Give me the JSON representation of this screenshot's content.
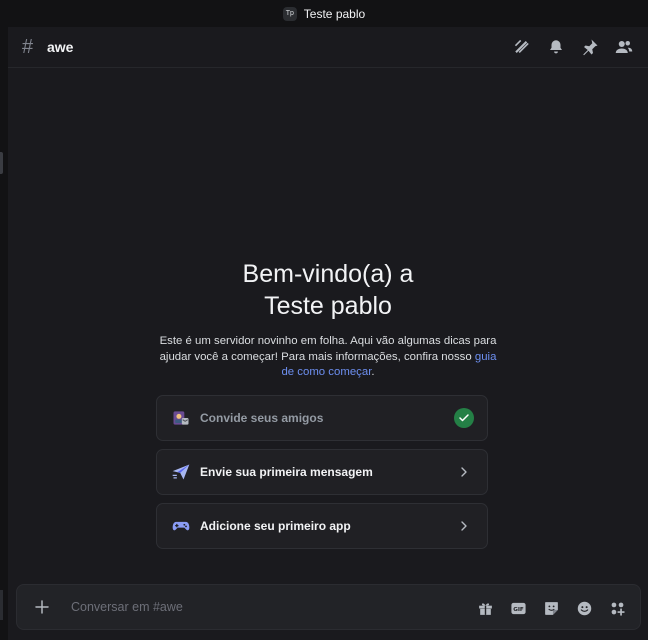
{
  "titlebar": {
    "server_abbrev": "Tp",
    "server_name": "Teste pablo"
  },
  "channel": {
    "hash_symbol": "#",
    "name": "awe"
  },
  "header_icons": [
    "threads-icon",
    "bell-icon",
    "pin-icon",
    "members-icon"
  ],
  "welcome": {
    "title_line1": "Bem-vindo(a) a",
    "title_line2": "Teste pablo",
    "desc_text": "Este é um servidor novinho em folha. Aqui vão algumas dicas para ajudar você a começar! Para mais informações, confira nosso ",
    "desc_link": "guia de como começar",
    "desc_end": "."
  },
  "cards": [
    {
      "label": "Convide seus amigos",
      "icon": "invite-friends-icon",
      "status": "done"
    },
    {
      "label": "Envie sua primeira mensagem",
      "icon": "paper-plane-icon",
      "status": "todo"
    },
    {
      "label": "Adicione seu primeiro app",
      "icon": "gamepad-icon",
      "status": "todo"
    }
  ],
  "composer": {
    "placeholder": "Conversar em #awe",
    "icons": [
      "gift-icon",
      "gif-icon",
      "sticker-icon",
      "emoji-icon",
      "apps-icon"
    ]
  },
  "colors": {
    "background": "#1a1a1e",
    "card_bg": "#202024",
    "link": "#6d8ff0",
    "success": "#248046"
  }
}
